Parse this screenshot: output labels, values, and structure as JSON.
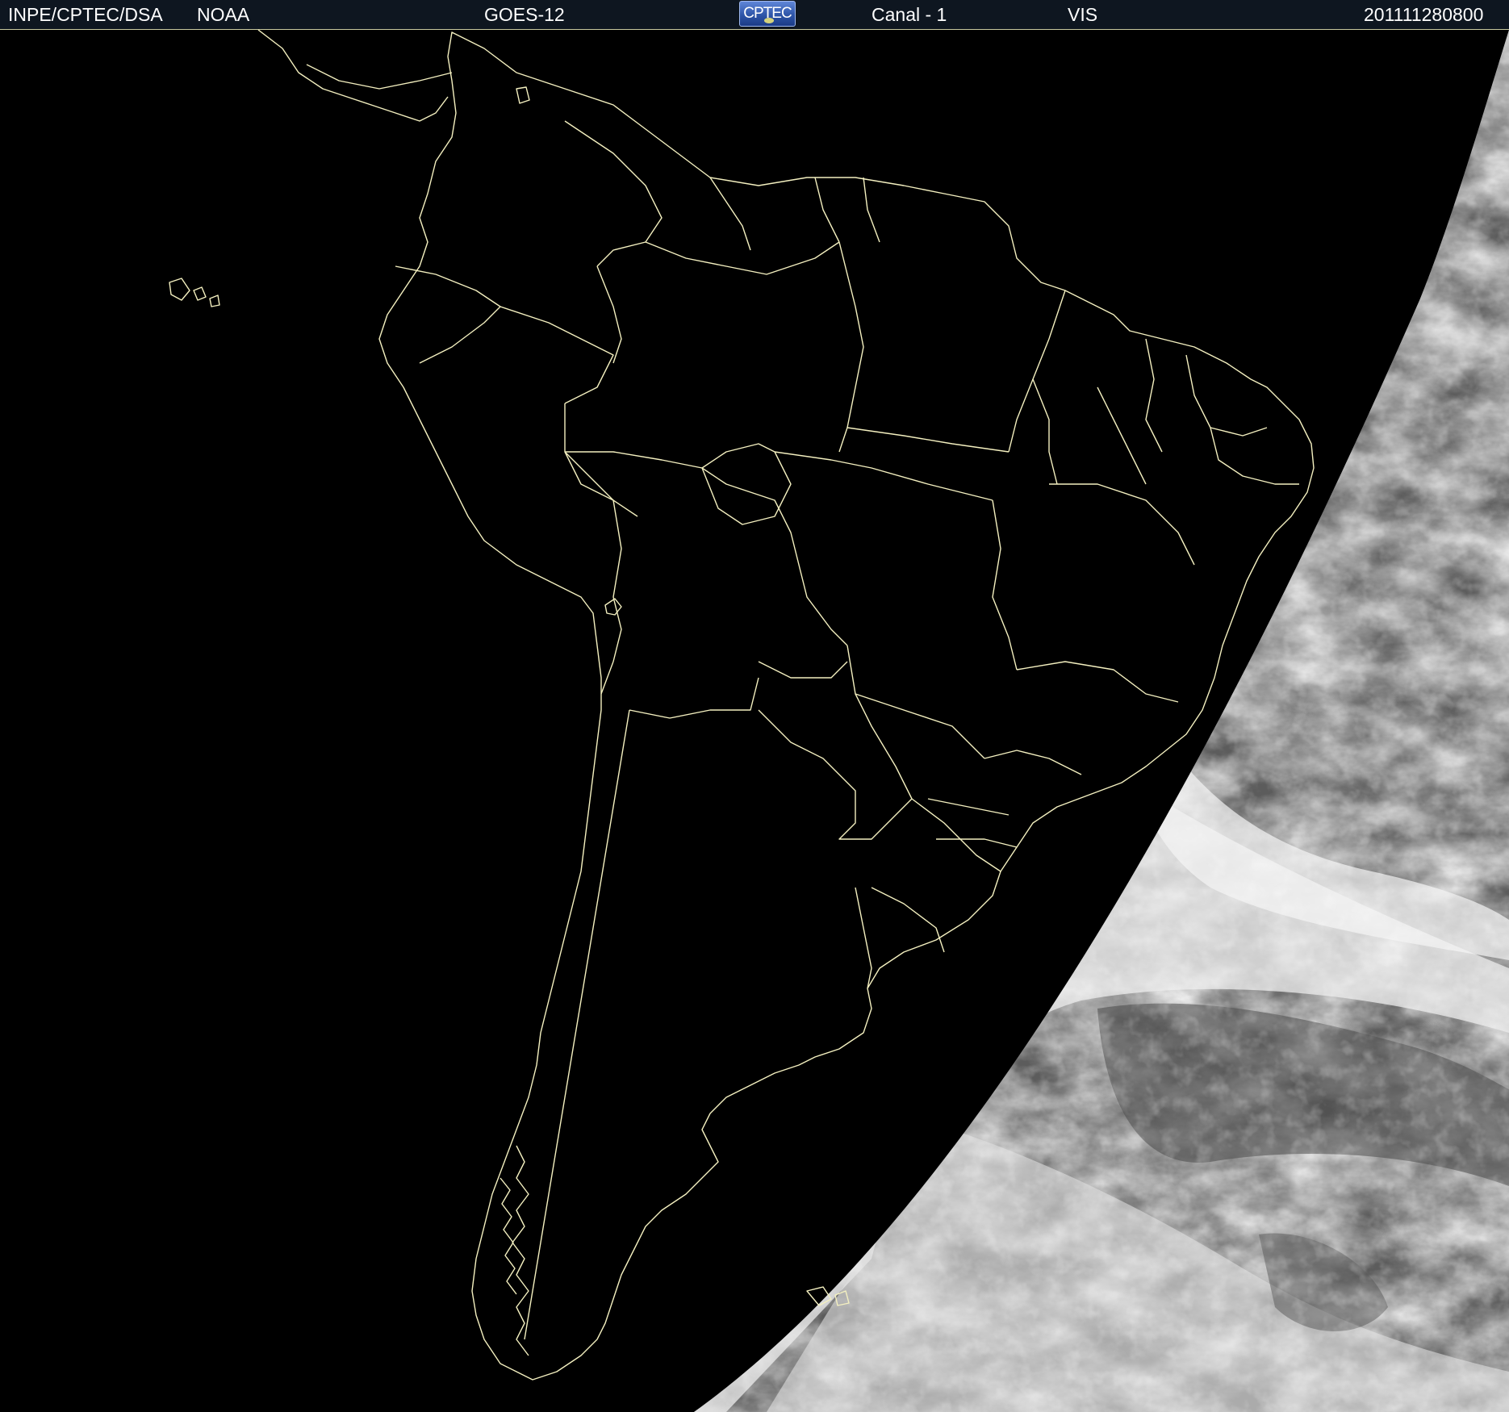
{
  "header": {
    "agency": "INPE/CPTEC/DSA",
    "source": "NOAA",
    "satellite": "GOES-12",
    "logo_text": "CPTEC",
    "channel": "Canal - 1",
    "band": "VIS",
    "timestamp": "201111280800"
  },
  "colors": {
    "header_bg": "#0e1620",
    "border_lines": "#f4f0c0",
    "space": "#000000",
    "cloud_light": "#e6e6e6",
    "cloud_gray": "#6a6a6a"
  },
  "map": {
    "type": "satellite visible-channel image",
    "region": "South America",
    "illuminated_side": "east"
  }
}
